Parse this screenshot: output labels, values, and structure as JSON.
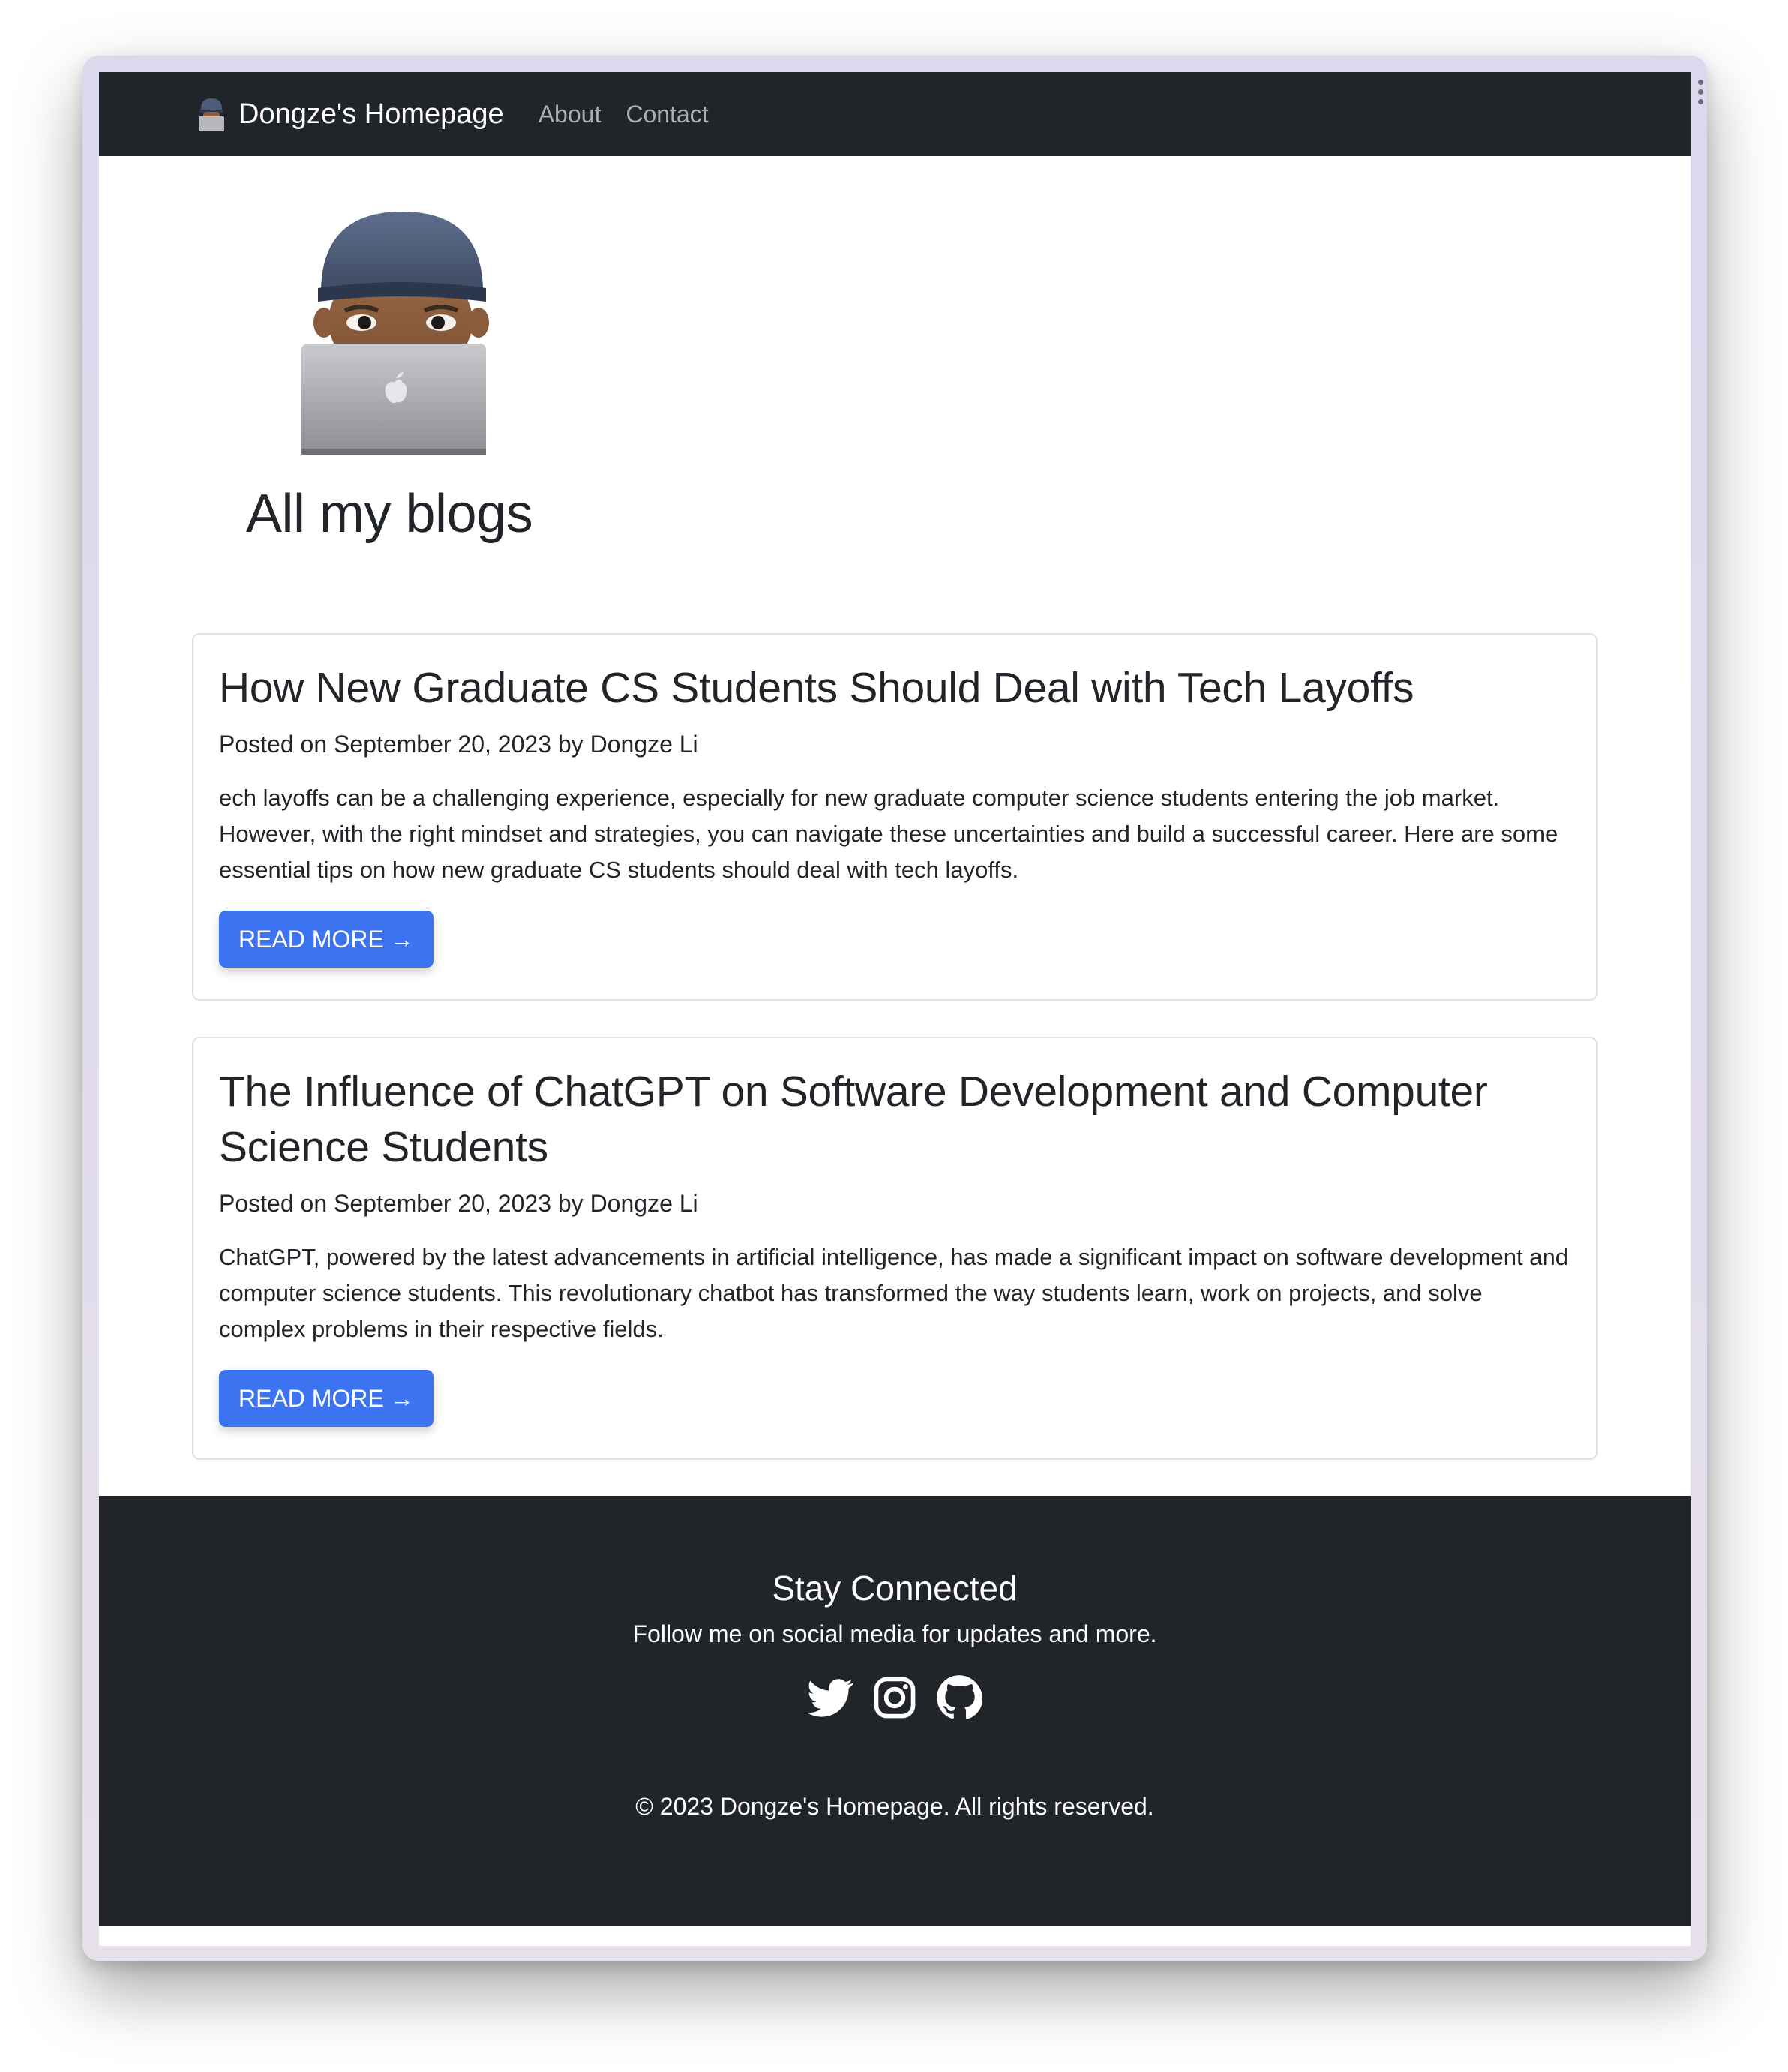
{
  "navbar": {
    "brand": "Dongze's Homepage",
    "brand_icon": "person-with-laptop-icon",
    "links": [
      "About",
      "Contact"
    ]
  },
  "hero": {
    "avatar_icon": "memoji-laptop-avatar",
    "title": "All my blogs"
  },
  "posts": [
    {
      "title": "How New Graduate CS Students Should Deal with Tech Layoffs",
      "meta": "Posted on September 20, 2023 by Dongze Li",
      "excerpt": "ech layoffs can be a challenging experience, especially for new graduate computer science students entering the job market. However, with the right mindset and strategies, you can navigate these uncertainties and build a successful career. Here are some essential tips on how new graduate CS students should deal with tech layoffs.",
      "button": "READ MORE",
      "button_arrow": "→"
    },
    {
      "title": "The Influence of ChatGPT on Software Development and Computer Science Students",
      "meta": "Posted on September 20, 2023 by Dongze Li",
      "excerpt": "ChatGPT, powered by the latest advancements in artificial intelligence, has made a significant impact on software development and computer science students. This revolutionary chatbot has transformed the way students learn, work on projects, and solve complex problems in their respective fields.",
      "button": "READ MORE",
      "button_arrow": "→"
    }
  ],
  "footer": {
    "heading": "Stay Connected",
    "subheading": "Follow me on social media for updates and more.",
    "social_icons": [
      "twitter-icon",
      "instagram-icon",
      "github-icon"
    ],
    "copyright": "© 2023 Dongze's Homepage. All rights reserved."
  },
  "colors": {
    "navbar_bg": "#212529",
    "button_bg": "#3b73f0",
    "text": "#212529"
  }
}
